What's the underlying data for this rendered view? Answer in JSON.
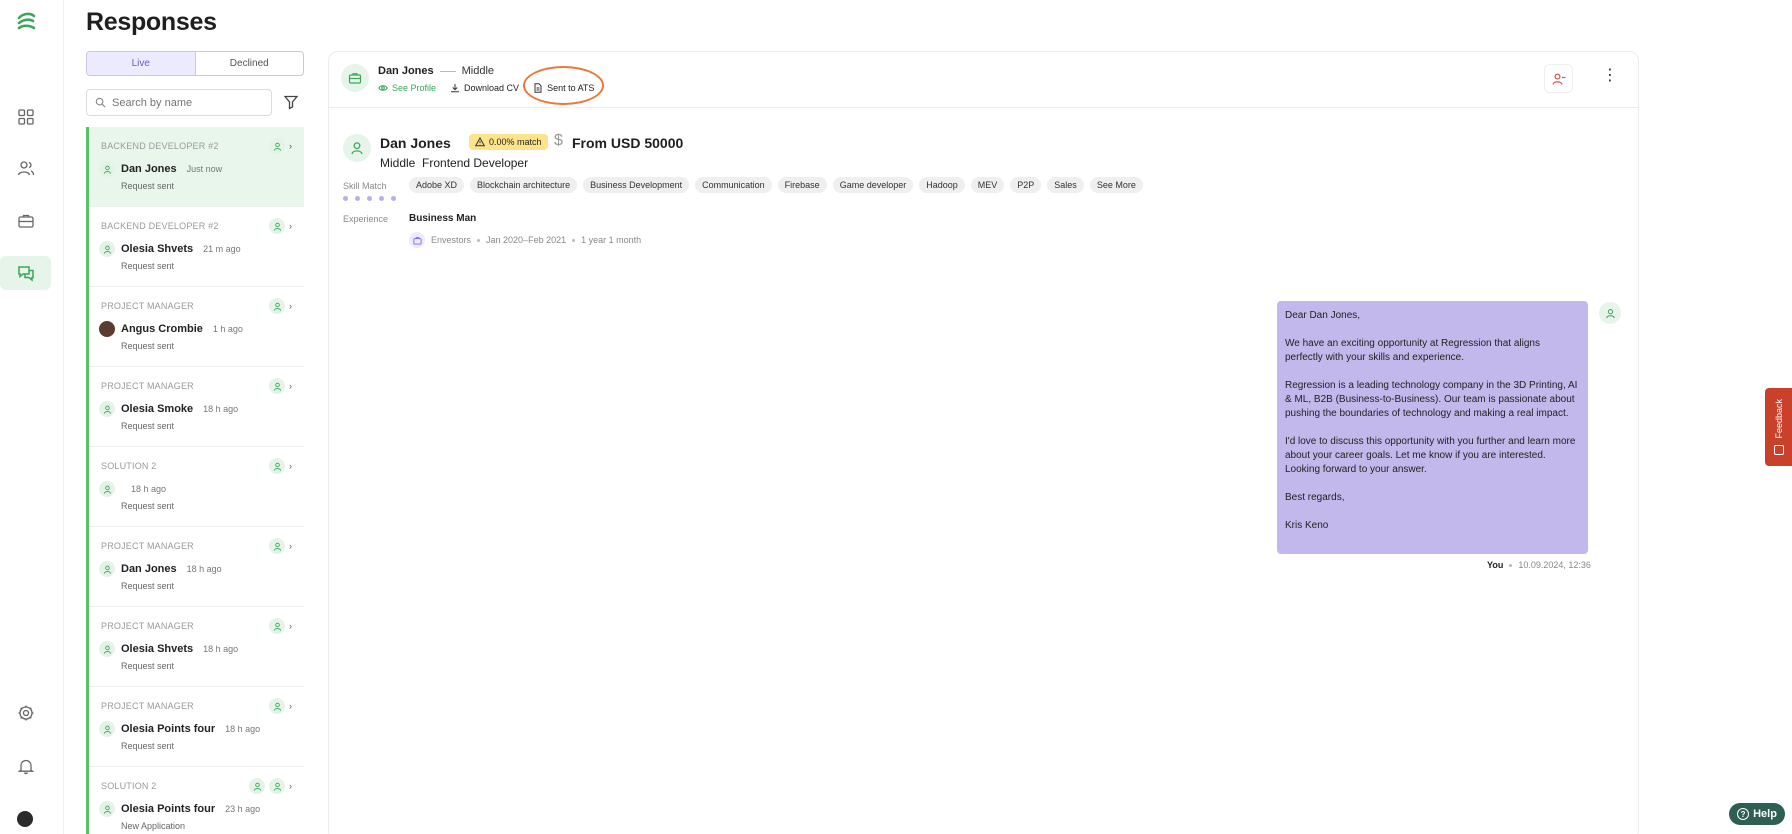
{
  "page": {
    "title": "Responses"
  },
  "rail": {
    "nav": [
      "dashboard-icon",
      "users-icon",
      "briefcase-icon",
      "chat-icon",
      "gear-icon",
      "bell-icon"
    ],
    "accent": "#3aa657"
  },
  "tabs": {
    "live": "Live",
    "declined": "Declined"
  },
  "search": {
    "placeholder": "Search by name"
  },
  "responses": [
    {
      "role": "BACKEND DEVELOPER #2",
      "name": "Dan Jones",
      "time": "Just now",
      "status": "Request sent"
    },
    {
      "role": "BACKEND DEVELOPER #2",
      "name": "Olesia Shvets",
      "time": "21 m ago",
      "status": "Request sent"
    },
    {
      "role": "PROJECT MANAGER",
      "name": "Angus Crombie",
      "time": "1 h ago",
      "status": "Request sent"
    },
    {
      "role": "PROJECT MANAGER",
      "name": "Olesia Smoke",
      "time": "18 h ago",
      "status": "Request sent"
    },
    {
      "role": "SOLUTION 2",
      "name": "",
      "time": "18 h ago",
      "status": "Request sent"
    },
    {
      "role": "PROJECT MANAGER",
      "name": "Dan Jones",
      "time": "18 h ago",
      "status": "Request sent"
    },
    {
      "role": "PROJECT MANAGER",
      "name": "Olesia Shvets",
      "time": "18 h ago",
      "status": "Request sent"
    },
    {
      "role": "PROJECT MANAGER",
      "name": "Olesia Points four",
      "time": "18 h ago",
      "status": "Request sent"
    },
    {
      "role": "SOLUTION 2",
      "name": "Olesia Points four",
      "time": "23 h ago",
      "status": "New Application"
    }
  ],
  "header": {
    "name": "Dan Jones",
    "level": "Middle",
    "see_profile": "See Profile",
    "download_cv": "Download CV",
    "sent_to_ats": "Sent to ATS"
  },
  "candidate": {
    "name": "Dan Jones",
    "match": "0.00% match",
    "salary": "From USD 50000",
    "level": "Middle",
    "title": "Frontend Developer",
    "skill_label": "Skill Match",
    "skills": [
      "Adobe XD",
      "Blockchain architecture",
      "Business Development",
      "Communication",
      "Firebase",
      "Game developer",
      "Hadoop",
      "MEV",
      "P2P",
      "Sales",
      "See More"
    ],
    "experience_label": "Experience",
    "experience_title": "Business Man",
    "experience_company": "Envestors",
    "experience_dates": "Jan 2020–Feb 2021",
    "experience_duration": "1 year 1 month"
  },
  "message": {
    "greeting": "Dear Dan Jones,",
    "p1": "We have an exciting opportunity at Regression that aligns perfectly with your skills and experience.",
    "p2": "Regression is a leading technology company in the 3D Printing, AI & ML, B2B (Business-to-Business). Our team is passionate about pushing the boundaries of technology and making a real impact.",
    "p3": "I'd love to discuss this opportunity with you further and learn more about your career goals. Let me know if you are interested. Looking forward to your answer.",
    "closing": "Best regards,",
    "signature": "Kris Keno",
    "sender": "You",
    "timestamp": "10.09.2024, 12:36",
    "bubble_color": "#c2b8eb"
  },
  "feedback": {
    "label": "Feedback"
  },
  "help": {
    "label": "Help"
  }
}
